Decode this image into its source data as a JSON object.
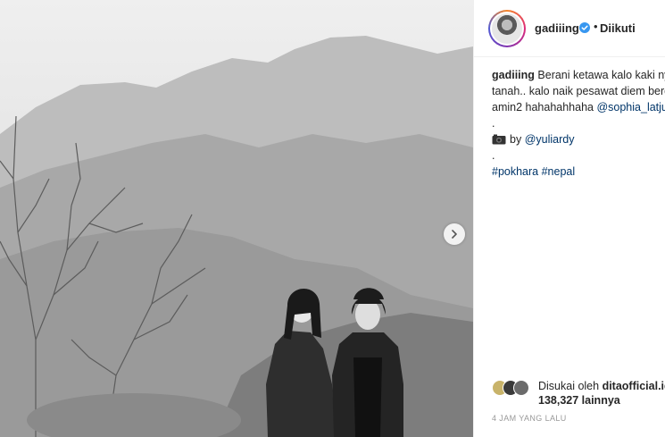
{
  "post": {
    "username": "gadiiing",
    "follow_dot": "•",
    "follow_status": "Diikuti",
    "caption": {
      "username": "gadiiing",
      "line1": "Berani ketawa kalo kaki ny",
      "line2": "tanah.. kalo naik pesawat diem berd",
      "line3_text": "amin2 hahahahhaha ",
      "line3_mention": "@sophia_latjul",
      "dot1": ".",
      "credit_prefix": "by ",
      "credit_mention": "@yuliardy",
      "dot2": ".",
      "hashtag1": "#pokhara",
      "hashtag2": "#nepal"
    },
    "likes": {
      "prefix": "Disukai oleh ",
      "user": "ditaofficial.id",
      "count_line": "138,327 lainnya"
    },
    "timestamp": "4 JAM YANG LALU"
  },
  "icons": {
    "verified": "verified-badge-icon",
    "camera": "camera-emoji-icon",
    "next": "chevron-right-icon"
  },
  "colors": {
    "verified_blue": "#3897f0",
    "link": "#003569",
    "muted": "#999999",
    "border": "#efefef"
  }
}
